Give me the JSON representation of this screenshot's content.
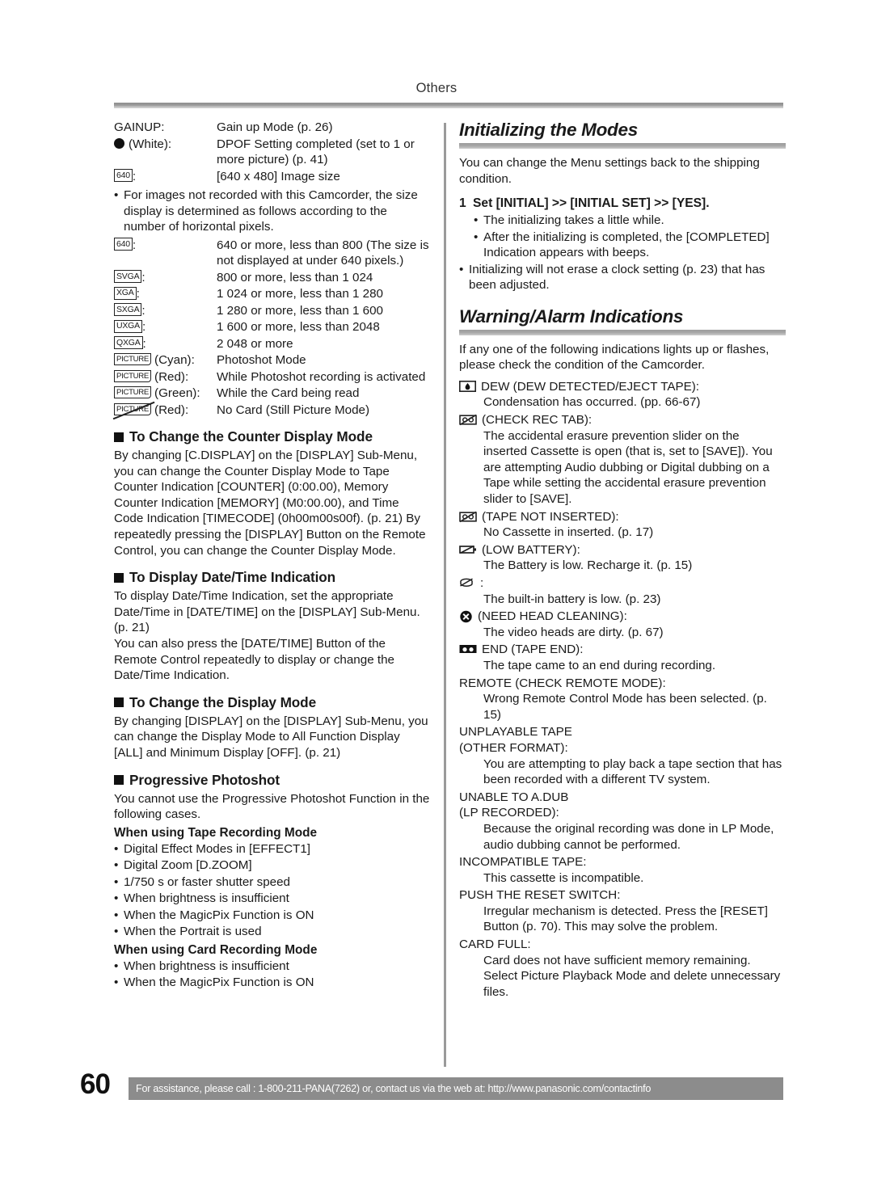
{
  "header": {
    "section_title": "Others"
  },
  "left_column": {
    "indicator_rows": [
      {
        "term_type": "text",
        "term": "GAINUP:",
        "desc": "Gain up Mode (p. 26)"
      },
      {
        "term_type": "dot",
        "term": "(White):",
        "desc": "DPOF Setting completed (set to 1 or more picture) (p. 41)"
      },
      {
        "term_type": "box",
        "term": "640",
        "suffix": ":",
        "desc": "[640 x 480] Image size"
      }
    ],
    "note_bullet": "For images not recorded with this Camcorder, the size display is determined as follows according to the number of horizontal pixels.",
    "size_rows": [
      {
        "box": "640",
        "desc": "640 or more, less than 800 (The size is not displayed at under 640 pixels.)"
      },
      {
        "box": "SVGA",
        "desc": "800 or more, less than 1 024"
      },
      {
        "box": "XGA",
        "desc": "1 024 or more, less than 1 280"
      },
      {
        "box": "SXGA",
        "desc": "1 280 or more, less than 1 600"
      },
      {
        "box": "UXGA",
        "desc": "1 600 or more, less than 2048"
      },
      {
        "box": "QXGA",
        "desc": "2 048 or more"
      }
    ],
    "picture_rows": [
      {
        "box": "PICTURE",
        "color_label": "(Cyan):",
        "slashed": false,
        "desc": "Photoshot Mode"
      },
      {
        "box": "PICTURE",
        "color_label": "(Red):",
        "slashed": false,
        "desc": "While Photoshot recording is activated"
      },
      {
        "box": "PICTURE",
        "color_label": "(Green):",
        "slashed": false,
        "desc": "While the Card being read"
      },
      {
        "box": "PICTURE",
        "color_label": "(Red):",
        "slashed": true,
        "desc": "No Card (Still Picture Mode)"
      }
    ],
    "sections": [
      {
        "heading": "To Change the Counter Display Mode",
        "body": "By changing [C.DISPLAY] on the [DISPLAY] Sub-Menu, you can change the Counter Display Mode to Tape Counter Indication [COUNTER] (0:00.00), Memory Counter Indication [MEMORY] (M0:00.00), and Time Code Indication [TIMECODE] (0h00m00s00f). (p. 21) By repeatedly pressing the [DISPLAY] Button on the Remote Control, you can change the Counter Display Mode."
      },
      {
        "heading": "To Display Date/Time Indication",
        "body": "To display Date/Time Indication, set the appropriate Date/Time in [DATE/TIME] on the [DISPLAY] Sub-Menu. (p. 21)",
        "body2": "You can also press the [DATE/TIME] Button of the Remote Control repeatedly to display or change the Date/Time Indication."
      },
      {
        "heading": "To Change the Display Mode",
        "body": "By changing [DISPLAY] on the [DISPLAY] Sub-Menu, you can change the Display Mode to All Function Display [ALL] and Minimum Display [OFF]. (p. 21)"
      }
    ],
    "progressive": {
      "heading": "Progressive Photoshot",
      "intro": "You cannot use the Progressive Photoshot Function in the following cases.",
      "tape_mode_heading": "When using Tape Recording Mode",
      "tape_mode_items": [
        "Digital Effect Modes in [EFFECT1]",
        "Digital Zoom [D.ZOOM]",
        "1/750 s or faster shutter speed",
        "When brightness is insufficient",
        "When the MagicPix Function is ON",
        "When the Portrait is used"
      ],
      "card_mode_heading": "When using Card Recording Mode",
      "card_mode_items": [
        "When brightness is insufficient",
        "When the MagicPix Function is ON"
      ]
    }
  },
  "right_column": {
    "initializing": {
      "heading": "Initializing the Modes",
      "intro": "You can change the Menu settings back to the shipping condition.",
      "step_number": "1",
      "step_text": "Set [INITIAL] >> [INITIAL SET] >> [YES].",
      "step_bullets": [
        "The initializing takes a little while.",
        "After the initializing is completed, the [COMPLETED] Indication appears with beeps."
      ],
      "outer_bullet": "Initializing will not erase a clock setting (p. 23) that has been adjusted."
    },
    "warnings": {
      "heading": "Warning/Alarm Indications",
      "intro": "If any one of the following indications lights up or flashes, please check the condition of the Camcorder.",
      "items": [
        {
          "icon": "dew-icon",
          "title": "DEW (DEW DETECTED/EJECT TAPE):",
          "body": "Condensation has occurred. (pp. 66-67)"
        },
        {
          "icon": "cassette-slash-icon",
          "title": "(CHECK REC TAB):",
          "body": "The accidental erasure prevention slider on the inserted Cassette is open (that is, set to [SAVE]). You are attempting Audio dubbing or Digital dubbing on a Tape while setting the accidental erasure prevention slider to [SAVE]."
        },
        {
          "icon": "cassette-slash-icon",
          "title": "(TAPE NOT INSERTED):",
          "body": "No Cassette in inserted. (p. 17)"
        },
        {
          "icon": "battery-slash-icon",
          "title": "(LOW BATTERY):",
          "body": "The Battery is low. Recharge it. (p. 15)"
        },
        {
          "icon": "builtin-battery-icon",
          "title": ":",
          "body": "The built-in battery is low. (p. 23)"
        },
        {
          "icon": "head-cleaning-icon",
          "title": "(NEED HEAD CLEANING):",
          "body": "The video heads are dirty. (p. 67)"
        },
        {
          "icon": "tape-end-icon",
          "title": "END (TAPE END):",
          "body": "The tape came to an end during recording."
        },
        {
          "icon": "none",
          "title": "REMOTE (CHECK REMOTE MODE):",
          "body": "Wrong Remote Control Mode has been selected. (p. 15)"
        },
        {
          "icon": "none",
          "title": "UNPLAYABLE TAPE",
          "title2": "(OTHER FORMAT):",
          "body": "You are attempting to play back a tape section that has been recorded with a different TV system."
        },
        {
          "icon": "none",
          "title": "UNABLE TO A.DUB",
          "title2": "(LP RECORDED):",
          "body": "Because the original recording was done in LP Mode, audio dubbing cannot be performed."
        },
        {
          "icon": "none",
          "title": "INCOMPATIBLE TAPE:",
          "body": "This cassette is incompatible."
        },
        {
          "icon": "none",
          "title": "PUSH THE RESET SWITCH:",
          "body": "Irregular mechanism is detected. Press the [RESET] Button (p. 70). This may solve the problem."
        },
        {
          "icon": "none",
          "title": "CARD FULL:",
          "body": "Card does not have sufficient memory remaining. Select Picture Playback Mode and delete unnecessary files."
        }
      ]
    }
  },
  "footer": {
    "page_number": "60",
    "notice": "For assistance, please call : 1-800-211-PANA(7262) or, contact us via the web at: http://www.panasonic.com/contactinfo"
  }
}
